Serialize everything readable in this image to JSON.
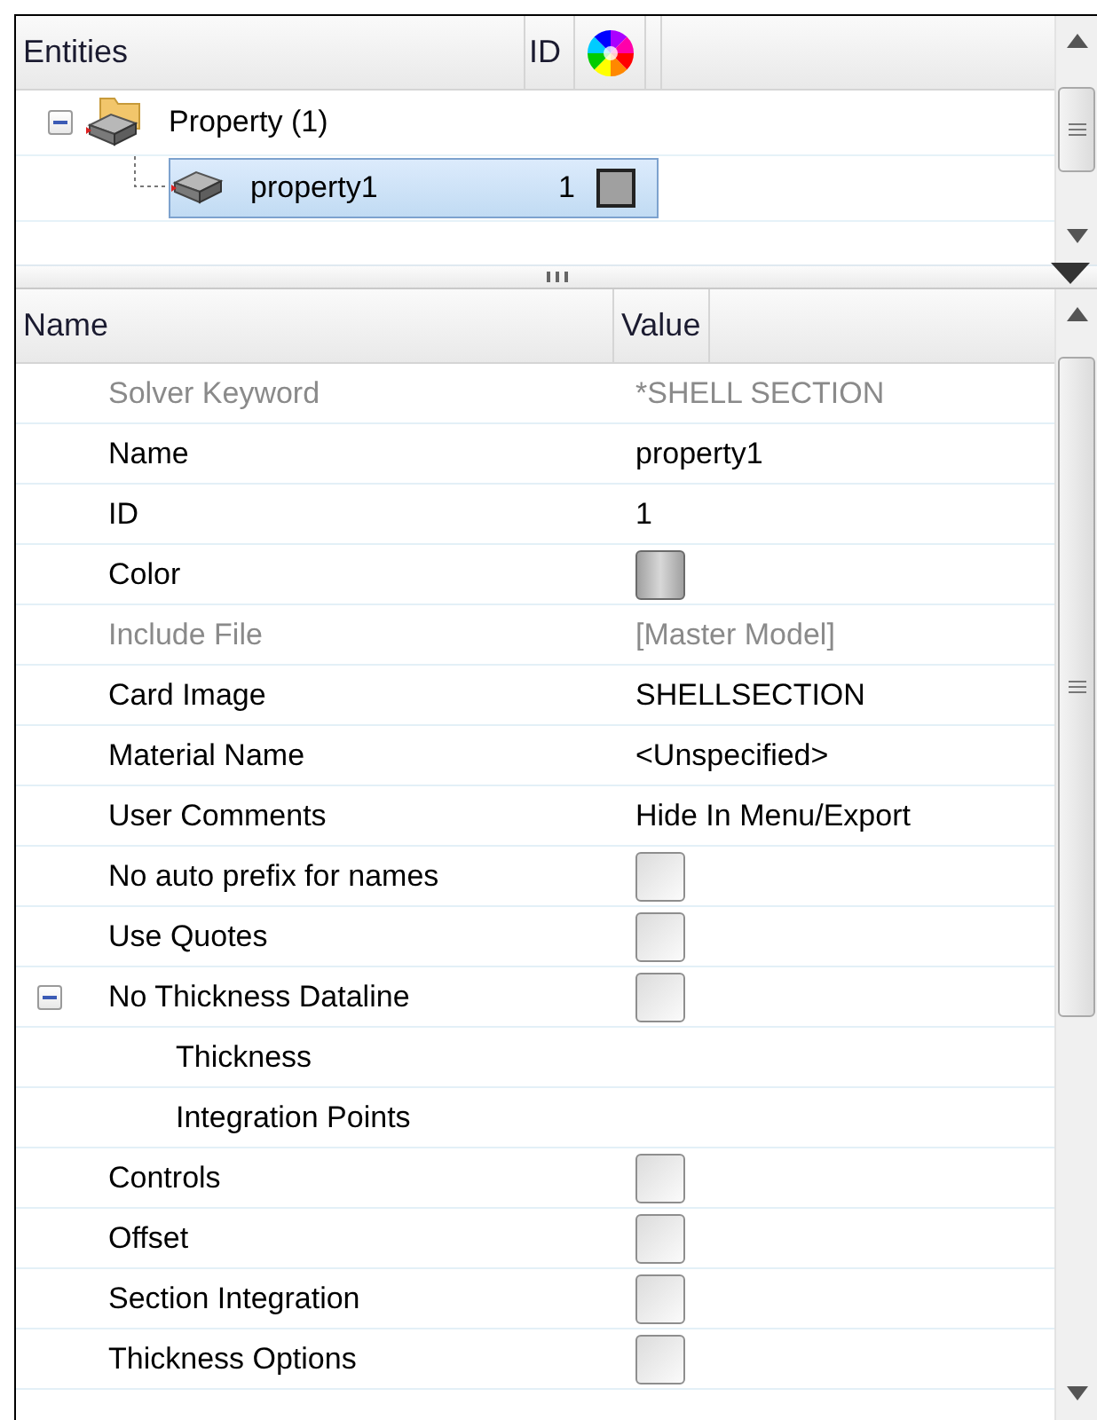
{
  "entities": {
    "columns": {
      "name": "Entities",
      "id": "ID"
    },
    "tree": [
      {
        "label": "Property (1)",
        "expanded": true,
        "selected": false,
        "children": [
          {
            "label": "property1",
            "id": "1",
            "color": "#a0a0a0",
            "selected": true
          }
        ]
      }
    ]
  },
  "properties": {
    "columns": {
      "name": "Name",
      "value": "Value"
    },
    "rows": [
      {
        "name": "Solver Keyword",
        "kind": "text",
        "value": "*SHELL SECTION",
        "disabled": true
      },
      {
        "name": "Name",
        "kind": "text",
        "value": "property1",
        "disabled": false
      },
      {
        "name": "ID",
        "kind": "text",
        "value": "1",
        "disabled": false
      },
      {
        "name": "Color",
        "kind": "color",
        "color": "#a0a0a0",
        "disabled": false
      },
      {
        "name": "Include File",
        "kind": "text",
        "value": "[Master Model]",
        "disabled": true
      },
      {
        "name": "Card Image",
        "kind": "text",
        "value": "SHELLSECTION",
        "disabled": false
      },
      {
        "name": "Material Name",
        "kind": "text",
        "value": "<Unspecified>",
        "disabled": false
      },
      {
        "name": "User Comments",
        "kind": "text",
        "value": "Hide In Menu/Export",
        "disabled": false
      },
      {
        "name": "No auto prefix for names",
        "kind": "checkbox",
        "checked": false,
        "disabled": false
      },
      {
        "name": "Use Quotes",
        "kind": "checkbox",
        "checked": false,
        "disabled": false
      },
      {
        "name": "No Thickness Dataline",
        "kind": "checkbox",
        "checked": false,
        "disabled": false,
        "expanded": true,
        "children": [
          {
            "name": "Thickness",
            "disabled": false
          },
          {
            "name": "Integration Points",
            "disabled": false
          }
        ]
      },
      {
        "name": "Controls",
        "kind": "checkbox",
        "checked": false,
        "disabled": false
      },
      {
        "name": "Offset",
        "kind": "checkbox",
        "checked": false,
        "disabled": false
      },
      {
        "name": "Section Integration",
        "kind": "checkbox",
        "checked": false,
        "disabled": false
      },
      {
        "name": "Thickness Options",
        "kind": "checkbox",
        "checked": false,
        "disabled": false
      }
    ]
  }
}
